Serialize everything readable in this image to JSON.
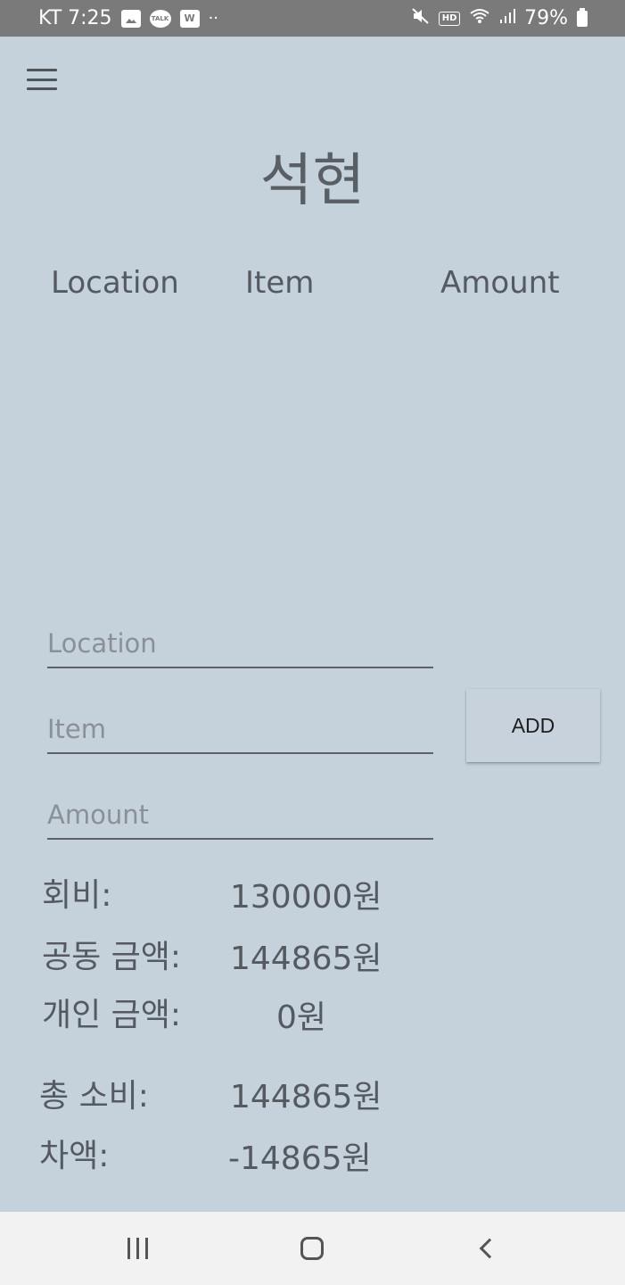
{
  "status_bar": {
    "carrier_time": "KT 7:25",
    "icons_left": [
      "gallery-icon",
      "kakaotalk-icon",
      "w-app-icon",
      "more-dots-icon"
    ],
    "talk_label": "TALK",
    "w_label": "W",
    "dots": "··",
    "hd_label": "HD",
    "battery": "79%"
  },
  "header": {
    "title": "석현"
  },
  "columns": {
    "location": "Location",
    "item": "Item",
    "amount": "Amount"
  },
  "form": {
    "location_placeholder": "Location",
    "item_placeholder": "Item",
    "amount_placeholder": "Amount",
    "location_value": "",
    "item_value": "",
    "amount_value": "",
    "add_label": "ADD"
  },
  "summary": {
    "dues_label": "회비:",
    "dues_value": "130000원",
    "shared_label": "공동 금액:",
    "shared_value": "144865원",
    "personal_label": "개인 금액:",
    "personal_value": "0원",
    "total_label": "총 소비:",
    "total_value": "144865원",
    "diff_label": "차액:",
    "diff_value": "-14865원"
  },
  "colors": {
    "background": "#c5d1db",
    "status_bar": "#7a7a7a",
    "nav_bar": "#f2f2f2",
    "text": "#555a61"
  }
}
